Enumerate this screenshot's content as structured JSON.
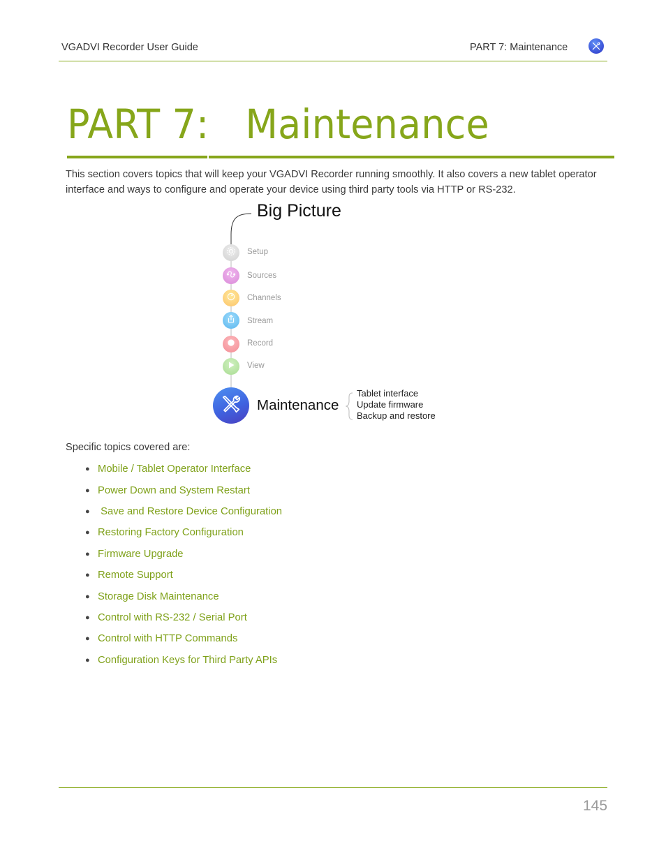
{
  "header": {
    "doc_title": "VGADVI Recorder User Guide",
    "section": "PART 7: Maintenance",
    "icon": "tools-icon"
  },
  "title": {
    "part": "PART 7:",
    "name": "Maintenance"
  },
  "intro": "This section covers topics that will keep your VGADVI Recorder running smoothly. It also covers a new tablet operator interface and ways to configure and operate your device using third party tools via HTTP or RS-232.",
  "big_picture": {
    "title": "Big Picture",
    "steps": [
      {
        "label": "Setup",
        "icon": "gear-icon",
        "color": "#d8d8d8"
      },
      {
        "label": "Sources",
        "icon": "sources-icon",
        "color": "#e39be0"
      },
      {
        "label": "Channels",
        "icon": "channels-icon",
        "color": "#fdd97a"
      },
      {
        "label": "Stream",
        "icon": "upload-icon",
        "color": "#7fcaf4"
      },
      {
        "label": "Record",
        "icon": "record-icon",
        "color": "#f7a3a8"
      },
      {
        "label": "View",
        "icon": "play-icon",
        "color": "#b9e6a6"
      }
    ],
    "current": {
      "label": "Maintenance",
      "icon": "tools-icon",
      "subitems": [
        "Tablet interface",
        "Update firmware",
        "Backup and restore"
      ]
    }
  },
  "topics": {
    "intro": "Specific topics covered are:",
    "items": [
      "Mobile / Tablet Operator Interface",
      "Power Down and System Restart",
      " Save and Restore Device Configuration",
      "Restoring Factory Configuration",
      "Firmware Upgrade",
      "Remote Support",
      "Storage Disk Maintenance",
      "Control with RS-232 / Serial Port",
      "Control with HTTP Commands",
      "Configuration Keys for Third Party APIs"
    ]
  },
  "footer": {
    "page_number": "145"
  },
  "colors": {
    "accent": "#86a61a",
    "link": "#7fa11a",
    "maintenance_blue": "#3f63e0"
  }
}
